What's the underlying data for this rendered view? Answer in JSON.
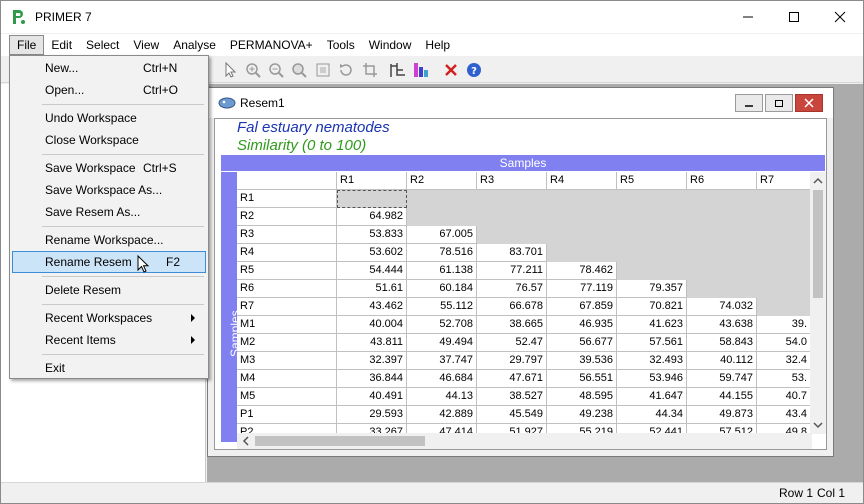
{
  "app": {
    "title": "PRIMER 7"
  },
  "menubar": [
    "File",
    "Edit",
    "Select",
    "View",
    "Analyse",
    "PERMANOVA+",
    "Tools",
    "Window",
    "Help"
  ],
  "file_menu": {
    "new": {
      "label": "New...",
      "shortcut": "Ctrl+N"
    },
    "open": {
      "label": "Open...",
      "shortcut": "Ctrl+O"
    },
    "undo_workspace": {
      "label": "Undo Workspace"
    },
    "close_workspace": {
      "label": "Close Workspace"
    },
    "save_workspace": {
      "label": "Save Workspace",
      "shortcut": "Ctrl+S"
    },
    "save_workspace_as": {
      "label": "Save Workspace As..."
    },
    "save_resem_as": {
      "label": "Save Resem As..."
    },
    "rename_workspace": {
      "label": "Rename Workspace..."
    },
    "rename_resem": {
      "label": "Rename Resem",
      "shortcut": "F2"
    },
    "delete_resem": {
      "label": "Delete Resem"
    },
    "recent_workspaces": {
      "label": "Recent Workspaces"
    },
    "recent_items": {
      "label": "Recent Items"
    },
    "exit": {
      "label": "Exit"
    }
  },
  "child_window": {
    "title": "Resem1",
    "sheet_title": "Fal estuary nematodes",
    "subtitle": "Similarity (0 to 100)",
    "samples_label": "Samples",
    "columns": [
      "R1",
      "R2",
      "R3",
      "R4",
      "R5",
      "R6",
      "R7"
    ],
    "rows": [
      {
        "label": "R1",
        "values": []
      },
      {
        "label": "R2",
        "values": [
          "64.982"
        ]
      },
      {
        "label": "R3",
        "values": [
          "53.833",
          "67.005"
        ]
      },
      {
        "label": "R4",
        "values": [
          "53.602",
          "78.516",
          "83.701"
        ]
      },
      {
        "label": "R5",
        "values": [
          "54.444",
          "61.138",
          "77.211",
          "78.462"
        ]
      },
      {
        "label": "R6",
        "values": [
          "51.61",
          "60.184",
          "76.57",
          "77.119",
          "79.357"
        ]
      },
      {
        "label": "R7",
        "values": [
          "43.462",
          "55.112",
          "66.678",
          "67.859",
          "70.821",
          "74.032"
        ]
      },
      {
        "label": "M1",
        "values": [
          "40.004",
          "52.708",
          "38.665",
          "46.935",
          "41.623",
          "43.638",
          "39."
        ]
      },
      {
        "label": "M2",
        "values": [
          "43.811",
          "49.494",
          "52.47",
          "56.677",
          "57.561",
          "58.843",
          "54.0"
        ]
      },
      {
        "label": "M3",
        "values": [
          "32.397",
          "37.747",
          "29.797",
          "39.536",
          "32.493",
          "40.112",
          "32.4"
        ]
      },
      {
        "label": "M4",
        "values": [
          "36.844",
          "46.684",
          "47.671",
          "56.551",
          "53.946",
          "59.747",
          "53."
        ]
      },
      {
        "label": "M5",
        "values": [
          "40.491",
          "44.13",
          "38.527",
          "48.595",
          "41.647",
          "44.155",
          "40.7"
        ]
      },
      {
        "label": "P1",
        "values": [
          "29.593",
          "42.889",
          "45.549",
          "49.238",
          "44.34",
          "49.873",
          "43.4"
        ]
      },
      {
        "label": "P2",
        "values": [
          "33.267",
          "47.414",
          "51.927",
          "55.219",
          "52.441",
          "57.512",
          "49.8"
        ]
      }
    ]
  },
  "status": {
    "row": "Row 1",
    "col": "Col 1"
  },
  "colors": {
    "samples_bar": "#8080f0",
    "title_blue": "#1a33b3",
    "title_green": "#2e9a1a",
    "highlight": "#cce4f7"
  },
  "toolbar_icons": [
    "select-icon",
    "zoom-in-icon",
    "zoom-out-icon",
    "zoom-reset-icon",
    "frame-icon",
    "rotate-icon",
    "crop-icon",
    "tree-icon",
    "color-chart-icon",
    "delete-x-icon",
    "help-icon"
  ]
}
